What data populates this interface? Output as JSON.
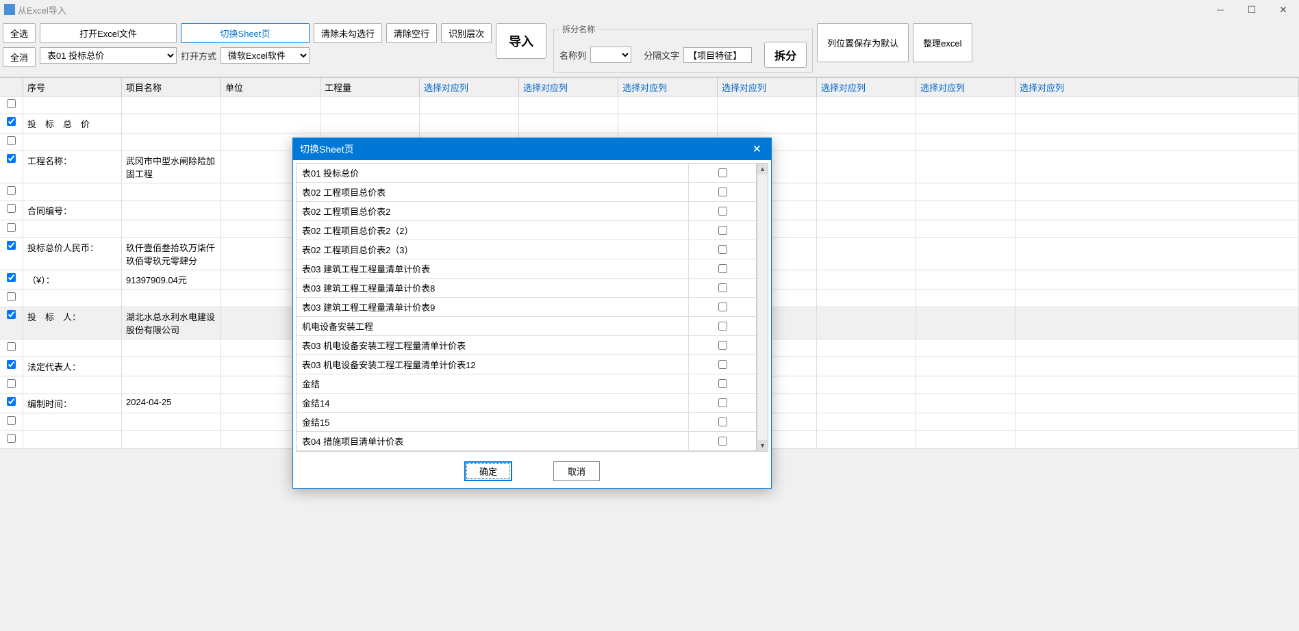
{
  "title": "从Excel导入",
  "toolbar": {
    "select_all": "全选",
    "deselect_all": "全消",
    "open_excel": "打开Excel文件",
    "switch_sheet": "切换Sheet页",
    "sheet_selected": "表01 投标总价",
    "clear_unchecked": "清除未勾选行",
    "clear_empty": "清除空行",
    "open_method_label": "打开方式",
    "open_method_value": "微软Excel软件",
    "identify_level": "识别层次",
    "import": "导入",
    "split_group": "拆分名称",
    "name_col": "名称列",
    "split_text": "分隔文字",
    "split_text_value": "【项目特征】",
    "split": "拆分",
    "save_cols": "列位置保存为默认",
    "tidy_excel": "整理excel"
  },
  "headers": {
    "seq": "序号",
    "name": "项目名称",
    "unit": "单位",
    "qty": "工程量",
    "select_col": "选择对应列"
  },
  "rows": [
    {
      "chk": false,
      "seq": "",
      "name": ""
    },
    {
      "chk": true,
      "seq": "投　标　总　价",
      "name": ""
    },
    {
      "chk": false,
      "seq": "",
      "name": ""
    },
    {
      "chk": true,
      "seq": "工程名称：",
      "name": "武冈市中型水闸除险加固工程"
    },
    {
      "chk": false,
      "seq": "",
      "name": ""
    },
    {
      "chk": false,
      "seq": "合同编号：",
      "name": ""
    },
    {
      "chk": false,
      "seq": "",
      "name": ""
    },
    {
      "chk": true,
      "seq": "投标总价人民币：",
      "name": "玖仟壹佰叁拾玖万柒仟玖佰零玖元零肆分"
    },
    {
      "chk": true,
      "seq": "（¥）：",
      "name": "9139790­9.04元"
    },
    {
      "chk": false,
      "seq": "",
      "name": ""
    },
    {
      "chk": true,
      "seq": "投　标　人：",
      "name": "湖北水总水利水电建设股份有限公司",
      "selected": true
    },
    {
      "chk": false,
      "seq": "",
      "name": ""
    },
    {
      "chk": true,
      "seq": "法定代表人：",
      "name": ""
    },
    {
      "chk": false,
      "seq": "",
      "name": ""
    },
    {
      "chk": true,
      "seq": "  编制时间：",
      "name": "2024-04-25"
    },
    {
      "chk": false,
      "seq": "",
      "name": ""
    },
    {
      "chk": false,
      "seq": "",
      "name": ""
    }
  ],
  "dialog": {
    "title": "切换Sheet页",
    "ok": "确定",
    "cancel": "取消",
    "items": [
      "表01 投标总价",
      "表02 工程项目总价表",
      "表02 工程项目总价表2",
      "表02 工程项目总价表2（2）",
      "表02 工程项目总价表2（3）",
      "表03 建筑工程工程量清单计价表",
      "表03 建筑工程工程量清单计价表8",
      "表03 建筑工程工程量清单计价表9",
      "机电设备安装工程",
      "表03 机电设备安装工程工程量清单计价表",
      "表03 机电设备安装工程工程量清单计价表12",
      "金结",
      "金结14",
      "金结15",
      "表04 措施项目清单计价表"
    ]
  }
}
